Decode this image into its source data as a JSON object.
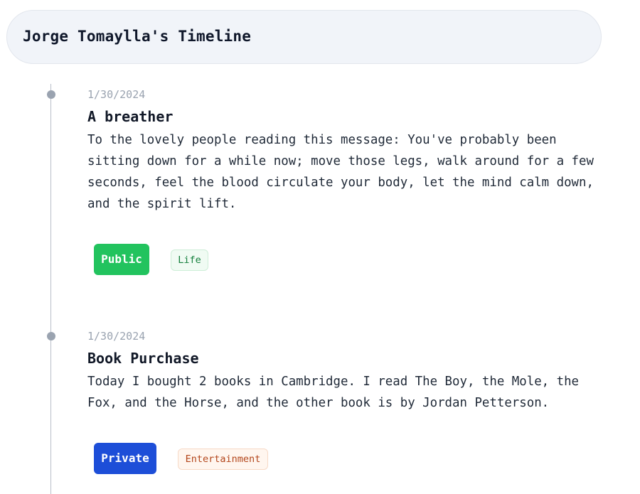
{
  "header": {
    "title": "Jorge Tomaylla's Timeline"
  },
  "colors": {
    "public_badge": "#22c35e",
    "private_badge": "#1d4ed8",
    "life_tag_bg": "#f0fbf3",
    "life_tag_text": "#15803d",
    "entertainment_tag_bg": "#fff6ef",
    "entertainment_tag_text": "#b3461b",
    "timeline_dot": "#9aa3b0"
  },
  "entries": [
    {
      "date": "1/30/2024",
      "title": "A breather",
      "body": "To the lovely people reading this message: You've probably been\nsitting down for a while now; move those legs, walk around for a few\nseconds, feel the blood circulate your body, let the mind calm down,\nand the spirit lift.",
      "visibility": "Public",
      "category": "Life"
    },
    {
      "date": "1/30/2024",
      "title": "Book Purchase",
      "body": "Today I bought 2 books in Cambridge. I read The Boy, the Mole, the\nFox, and the Horse, and the other book is by Jordan Petterson.",
      "visibility": "Private",
      "category": "Entertainment"
    }
  ]
}
